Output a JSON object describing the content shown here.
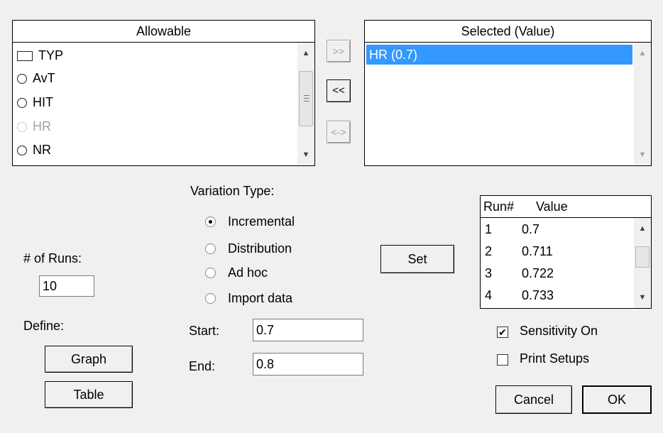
{
  "allowable": {
    "header": "Allowable",
    "items": [
      {
        "label": "TYP",
        "symbol": "rect",
        "enabled": true
      },
      {
        "label": "AvT",
        "symbol": "circle",
        "enabled": true
      },
      {
        "label": "HIT",
        "symbol": "circle",
        "enabled": true
      },
      {
        "label": "HR",
        "symbol": "circle",
        "enabled": false
      },
      {
        "label": "NR",
        "symbol": "circle",
        "enabled": true
      }
    ]
  },
  "transfer": {
    "add_label": ">>",
    "remove_label": "<<",
    "swap_label": "<->"
  },
  "selected": {
    "header": "Selected  (Value)",
    "items": [
      "HR (0.7)"
    ]
  },
  "variation": {
    "title": "Variation Type:",
    "options": [
      {
        "label": "Incremental",
        "checked": true
      },
      {
        "label": "Distribution",
        "checked": false
      },
      {
        "label": "Ad hoc",
        "checked": false
      },
      {
        "label": "Import data",
        "checked": false
      }
    ],
    "start_label": "Start:",
    "start_value": "0.7",
    "end_label": "End:",
    "end_value": "0.8"
  },
  "runs": {
    "label": "# of Runs:",
    "value": "10"
  },
  "define": {
    "label": "Define:",
    "graph_label": "Graph",
    "table_label": "Table"
  },
  "set_label": "Set",
  "run_table": {
    "col_run": "Run#",
    "col_value": "Value",
    "rows": [
      {
        "run": "1",
        "value": "0.7"
      },
      {
        "run": "2",
        "value": "0.711"
      },
      {
        "run": "3",
        "value": "0.722"
      },
      {
        "run": "4",
        "value": "0.733"
      }
    ]
  },
  "options": {
    "sensitivity_label": "Sensitivity On",
    "sensitivity_checked": true,
    "print_setups_label": "Print Setups",
    "print_setups_checked": false
  },
  "dialog": {
    "cancel_label": "Cancel",
    "ok_label": "OK"
  },
  "colors": {
    "selection": "#3399ff",
    "background": "#f0f0f0",
    "disabled_text": "#a0a0a0"
  }
}
